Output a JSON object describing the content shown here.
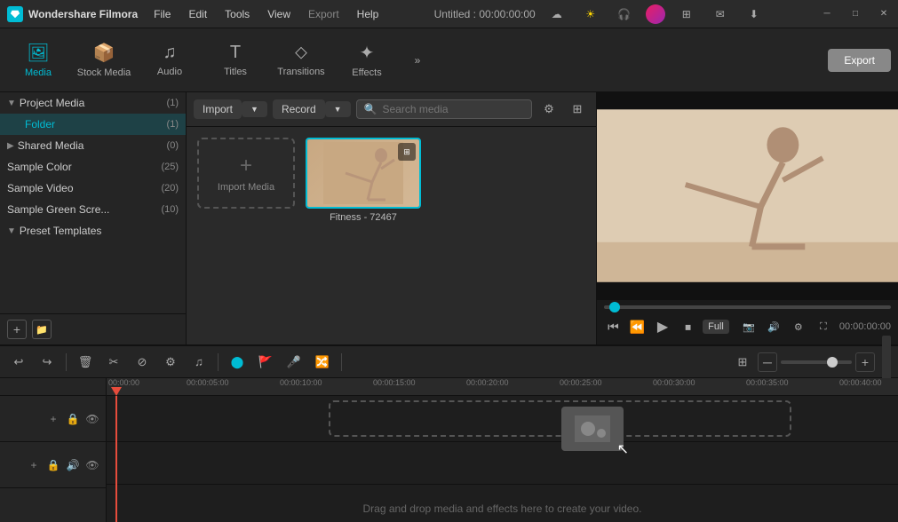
{
  "app": {
    "name": "Wondershare Filmora",
    "title": "Untitled : 00:00:00:00"
  },
  "menu": {
    "items": [
      "File",
      "Edit",
      "Tools",
      "View",
      "Export",
      "Help"
    ]
  },
  "toolbar": {
    "tabs": [
      {
        "id": "media",
        "label": "Media",
        "icon": "media"
      },
      {
        "id": "stock",
        "label": "Stock Media",
        "icon": "stock"
      },
      {
        "id": "audio",
        "label": "Audio",
        "icon": "audio"
      },
      {
        "id": "titles",
        "label": "Titles",
        "icon": "titles"
      },
      {
        "id": "transitions",
        "label": "Transitions",
        "icon": "transitions"
      },
      {
        "id": "effects",
        "label": "Effects",
        "icon": "effects"
      }
    ],
    "export_label": "Export"
  },
  "left_panel": {
    "project_media": "Project Media",
    "project_count": "(1)",
    "folder_label": "Folder",
    "folder_count": "(1)",
    "shared_media": "Shared Media",
    "shared_count": "(0)",
    "sample_color": "Sample Color",
    "sample_color_count": "(25)",
    "sample_video": "Sample Video",
    "sample_video_count": "(20)",
    "sample_green": "Sample Green Scre...",
    "sample_green_count": "(10)",
    "preset_templates": "Preset Templates"
  },
  "media_panel": {
    "import_label": "Import",
    "record_label": "Record",
    "search_placeholder": "Search media",
    "import_media_label": "Import Media",
    "media_item_label": "Fitness - 72467"
  },
  "preview": {
    "time_display": "00:00:00:00",
    "quality": "Full"
  },
  "timeline": {
    "time_markers": [
      "00:00:00",
      "00:00:05:00",
      "00:00:10:00",
      "00:00:15:00",
      "00:00:20:00",
      "00:00:25:00",
      "00:00:30:00",
      "00:00:35:00",
      "00:00:40:00"
    ],
    "drop_zone_text": "Drag and drop media and effects here to create your video."
  },
  "colors": {
    "accent": "#00bcd4",
    "playhead": "#e74c3c",
    "bg_dark": "#1e1e1e",
    "bg_panel": "#252525"
  }
}
